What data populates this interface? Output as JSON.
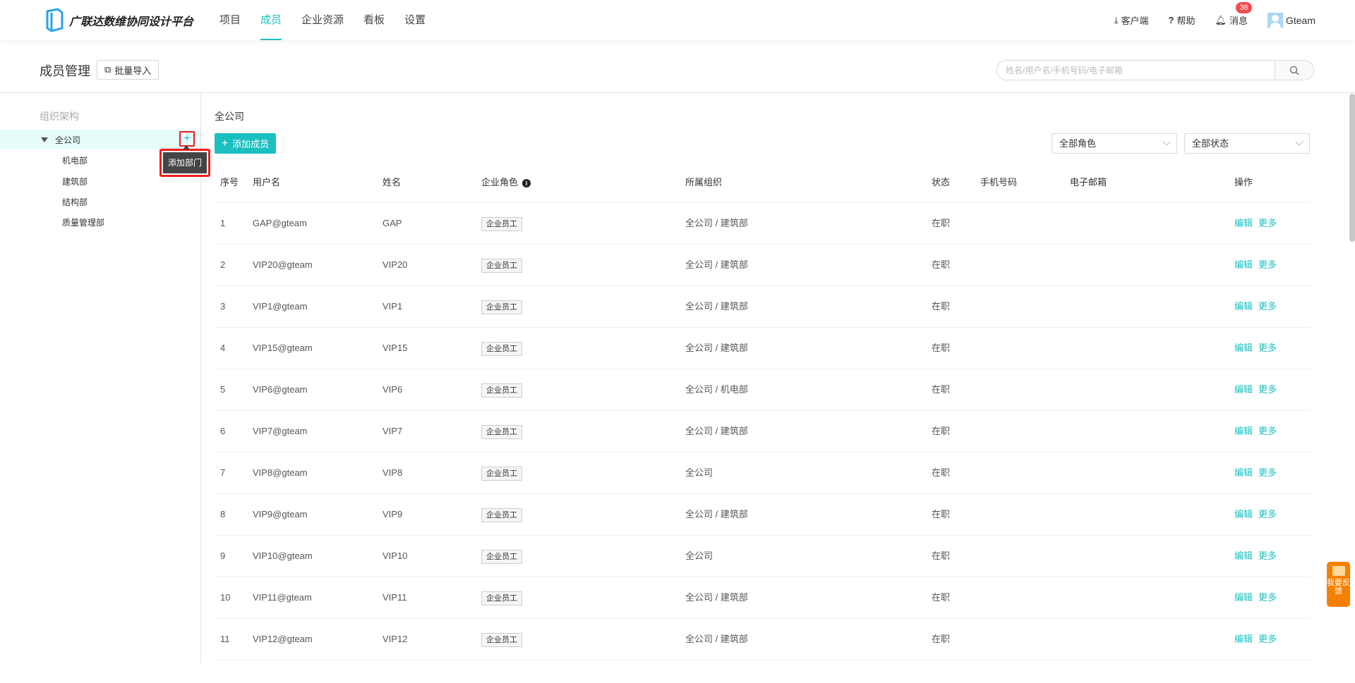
{
  "header": {
    "brand": "广联达数维协同设计平台",
    "nav": [
      "项目",
      "成员",
      "企业资源",
      "看板",
      "设置"
    ],
    "active_nav": "成员",
    "client": "客户端",
    "help": "帮助",
    "messages": "消息",
    "message_count": "36",
    "user": "Gteam"
  },
  "titlebar": {
    "title": "成员管理",
    "import": "批量导入",
    "search_placeholder": "姓名/用户名/手机号码/电子邮箱"
  },
  "org": {
    "title": "组织架构",
    "root": "全公司",
    "add_tooltip": "添加部门",
    "depts": [
      "机电部",
      "建筑部",
      "结构部",
      "质量管理部"
    ]
  },
  "main": {
    "label": "全公司",
    "add_member": "添加成员",
    "role_filter": "全部角色",
    "status_filter": "全部状态"
  },
  "table": {
    "headers": [
      "序号",
      "用户名",
      "姓名",
      "企业角色",
      "所属组织",
      "状态",
      "手机号码",
      "电子邮箱",
      "操作"
    ],
    "edit": "编辑",
    "more": "更多",
    "rows": [
      {
        "no": "1",
        "username": "GAP@gteam",
        "name": "GAP",
        "role": "企业员工",
        "org": "全公司 / 建筑部",
        "status": "在职"
      },
      {
        "no": "2",
        "username": "VIP20@gteam",
        "name": "VIP20",
        "role": "企业员工",
        "org": "全公司 / 建筑部",
        "status": "在职"
      },
      {
        "no": "3",
        "username": "VIP1@gteam",
        "name": "VIP1",
        "role": "企业员工",
        "org": "全公司 / 建筑部",
        "status": "在职"
      },
      {
        "no": "4",
        "username": "VIP15@gteam",
        "name": "VIP15",
        "role": "企业员工",
        "org": "全公司 / 建筑部",
        "status": "在职"
      },
      {
        "no": "5",
        "username": "VIP6@gteam",
        "name": "VIP6",
        "role": "企业员工",
        "org": "全公司 / 机电部",
        "status": "在职"
      },
      {
        "no": "6",
        "username": "VIP7@gteam",
        "name": "VIP7",
        "role": "企业员工",
        "org": "全公司 / 建筑部",
        "status": "在职"
      },
      {
        "no": "7",
        "username": "VIP8@gteam",
        "name": "VIP8",
        "role": "企业员工",
        "org": "全公司",
        "status": "在职"
      },
      {
        "no": "8",
        "username": "VIP9@gteam",
        "name": "VIP9",
        "role": "企业员工",
        "org": "全公司 / 建筑部",
        "status": "在职"
      },
      {
        "no": "9",
        "username": "VIP10@gteam",
        "name": "VIP10",
        "role": "企业员工",
        "org": "全公司",
        "status": "在职"
      },
      {
        "no": "10",
        "username": "VIP11@gteam",
        "name": "VIP11",
        "role": "企业员工",
        "org": "全公司 / 建筑部",
        "status": "在职"
      },
      {
        "no": "11",
        "username": "VIP12@gteam",
        "name": "VIP12",
        "role": "企业员工",
        "org": "全公司 / 建筑部",
        "status": "在职"
      }
    ]
  },
  "feedback": "我要反馈"
}
